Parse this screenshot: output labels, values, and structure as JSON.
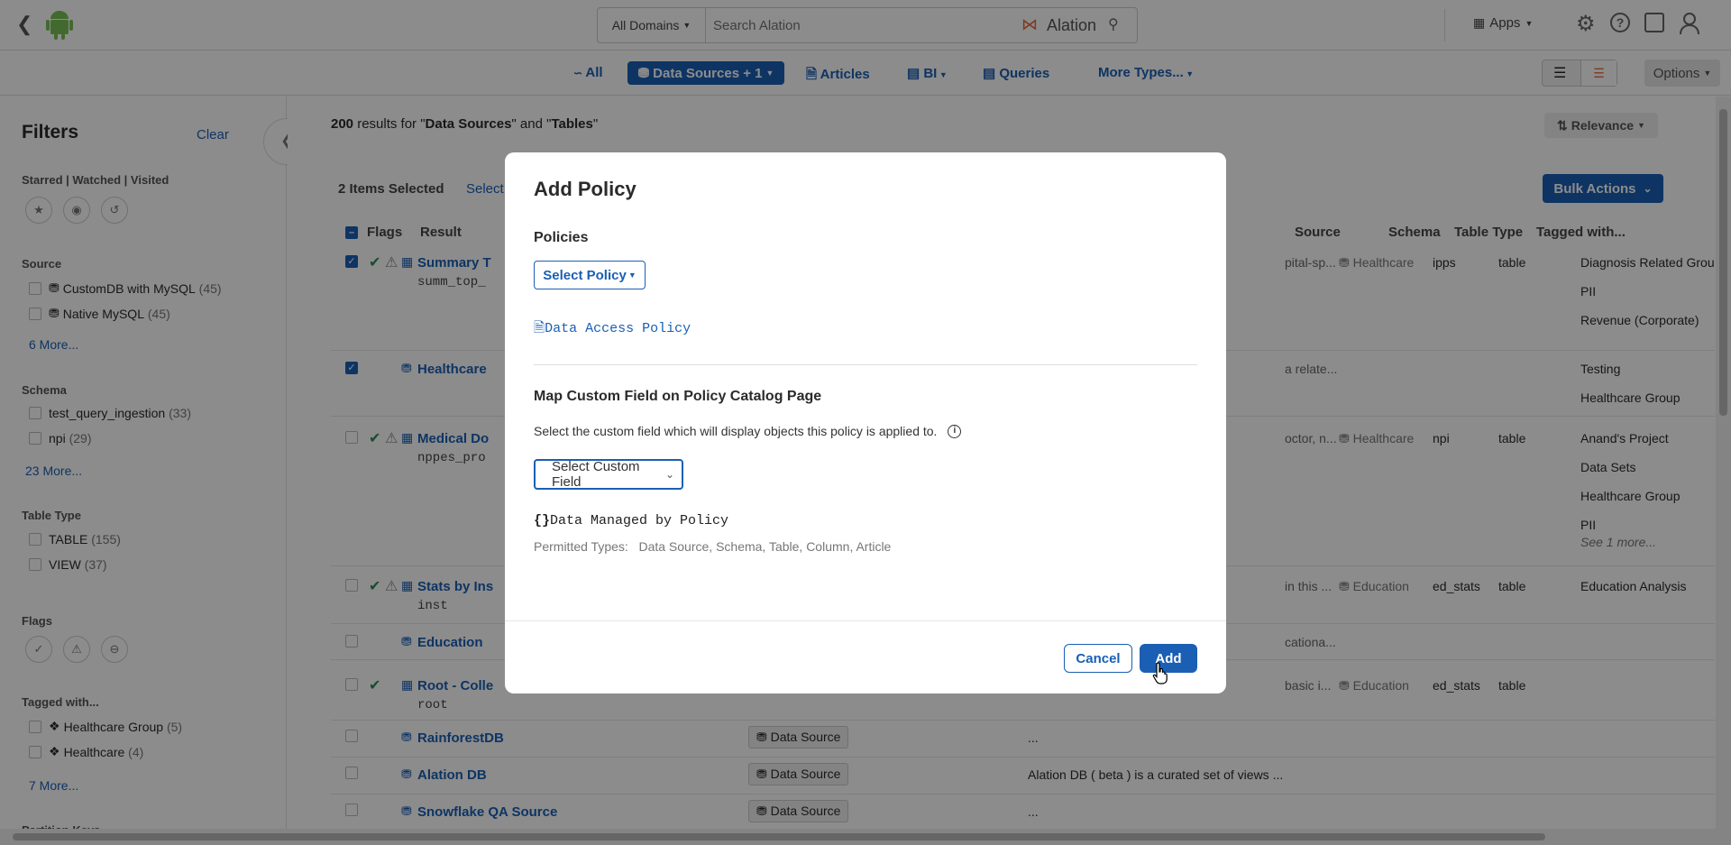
{
  "header": {
    "domain_select": "All Domains",
    "search_placeholder": "Search Alation",
    "brand": "Alation",
    "apps": "Apps"
  },
  "typebar": {
    "items": [
      "All",
      "Data Sources + 1",
      "Articles",
      "BI",
      "Queries",
      "More Types..."
    ],
    "options": "Options"
  },
  "filters": {
    "title": "Filters",
    "clear": "Clear",
    "starred_label": "Starred | Watched | Visited",
    "source_label": "Source",
    "source_items": [
      {
        "label": "CustomDB with MySQL",
        "count": "(45)"
      },
      {
        "label": "Native MySQL",
        "count": "(45)"
      }
    ],
    "source_more": "6 More...",
    "schema_label": "Schema",
    "schema_items": [
      {
        "label": "test_query_ingestion",
        "count": "(33)"
      },
      {
        "label": "npi",
        "count": "(29)"
      }
    ],
    "schema_more": "23 More...",
    "tabletype_label": "Table Type",
    "tabletype_items": [
      {
        "label": "TABLE",
        "count": "(155)"
      },
      {
        "label": "VIEW",
        "count": "(37)"
      }
    ],
    "flags_label": "Flags",
    "tagged_label": "Tagged with...",
    "tagged_items": [
      {
        "label": "Healthcare Group",
        "count": "(5)"
      },
      {
        "label": "Healthcare",
        "count": "(4)"
      }
    ],
    "tagged_more": "7 More...",
    "partition_label": "Partition Keys"
  },
  "results": {
    "count": "200",
    "text_mid": " results for \"",
    "term1": "Data Sources",
    "text_and": "\" and \"",
    "term2": "Tables",
    "text_end": "\"",
    "sort": "Relevance",
    "selected": "2 Items Selected",
    "select_link": "Select",
    "bulk": "Bulk Actions",
    "headers": {
      "flags": "Flags",
      "result": "Result",
      "source": "Source",
      "schema": "Schema",
      "tabletype": "Table Type",
      "tagged": "Tagged with..."
    },
    "rows": [
      {
        "title": "Summary T",
        "sub": "summ_top_",
        "desc": "pital-sp...",
        "source": "Healthcare",
        "schema": "ipps",
        "type": "table",
        "tags": [
          "Diagnosis Related Groups (DR",
          "PII",
          "Revenue (Corporate)"
        ]
      },
      {
        "title": "Healthcare",
        "sub": "",
        "desc": "a relate...",
        "source": "",
        "schema": "",
        "type": "",
        "tags": [
          "Testing",
          "Healthcare Group"
        ]
      },
      {
        "title": "Medical Do",
        "sub": "nppes_pro",
        "desc": "octor, n...",
        "source": "Healthcare",
        "schema": "npi",
        "type": "table",
        "tags": [
          "Anand's Project",
          "Data Sets",
          "Healthcare Group",
          "PII"
        ],
        "more": "See 1 more..."
      },
      {
        "title": "Stats by Ins",
        "sub": "inst",
        "desc": "in this ...",
        "source": "Education",
        "schema": "ed_stats",
        "type": "table",
        "tags": [
          "Education Analysis"
        ]
      },
      {
        "title": "Education",
        "sub": "",
        "desc": "cationa...",
        "source": "",
        "schema": "",
        "type": "",
        "tags": []
      },
      {
        "title": "Root - Colle",
        "sub": "root",
        "desc": "basic i...",
        "source": "Education",
        "schema": "ed_stats",
        "type": "table",
        "tags": []
      },
      {
        "title": "RainforestDB",
        "sub": "",
        "tag": "Data Source",
        "desc": "...",
        "tags": []
      },
      {
        "title": "Alation DB",
        "sub": "",
        "tag": "Data Source",
        "desc": "Alation DB ( beta ) is a curated set of views ...",
        "tags": []
      },
      {
        "title": "Snowflake QA Source",
        "sub": "",
        "tag": "Data Source",
        "desc": "...",
        "tags": []
      }
    ]
  },
  "modal": {
    "title": "Add Policy",
    "policies_label": "Policies",
    "select_policy": "Select Policy",
    "policy_link": "Data Access Policy",
    "map_title": "Map Custom Field on Policy Catalog Page",
    "map_desc": "Select the custom field which will display objects this policy is applied to.",
    "select_field": "Select Custom Field",
    "field_name": "Data Managed by Policy",
    "permitted_label": "Permitted Types:",
    "permitted_types": "Data Source, Schema, Table, Column, Article",
    "cancel": "Cancel",
    "add": "Add"
  },
  "colors": {
    "accent": "#1a5fb4",
    "success": "#2e8b57"
  }
}
